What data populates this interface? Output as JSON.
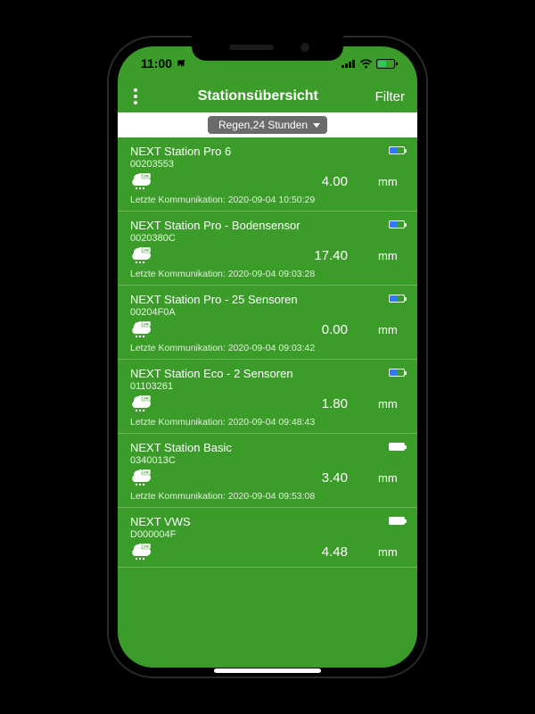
{
  "status": {
    "time": "11:00"
  },
  "nav": {
    "title": "Stationsübersicht",
    "filter": "Filter"
  },
  "dropdown": {
    "label": "Regen,24 Stunden"
  },
  "comm_prefix": "Letzte Kommunikation: ",
  "unit": "mm",
  "stations": [
    {
      "name": "NEXT Station Pro 6",
      "id": "00203553",
      "value": "4.00",
      "comm": "2020-09-04 10:50:29",
      "batt_pct": 55,
      "batt_color": "#2d7bff"
    },
    {
      "name": "NEXT Station Pro - Bodensensor",
      "id": "0020380C",
      "value": "17.40",
      "comm": "2020-09-04 09:03:28",
      "batt_pct": 55,
      "batt_color": "#2d7bff"
    },
    {
      "name": "NEXT Station Pro - 25 Sensoren",
      "id": "00204F0A",
      "value": "0.00",
      "comm": "2020-09-04 09:03:42",
      "batt_pct": 55,
      "batt_color": "#2d7bff"
    },
    {
      "name": "NEXT Station Eco - 2 Sensoren",
      "id": "01103261",
      "value": "1.80",
      "comm": "2020-09-04 09:48:43",
      "batt_pct": 55,
      "batt_color": "#2d7bff"
    },
    {
      "name": "NEXT Station Basic",
      "id": "0340013C",
      "value": "3.40",
      "comm": "2020-09-04 09:53:08",
      "batt_pct": 100,
      "batt_color": "#ffffff"
    },
    {
      "name": "NEXT VWS",
      "id": "D000004F",
      "value": "4.48",
      "comm": "",
      "batt_pct": 100,
      "batt_color": "#ffffff"
    }
  ]
}
